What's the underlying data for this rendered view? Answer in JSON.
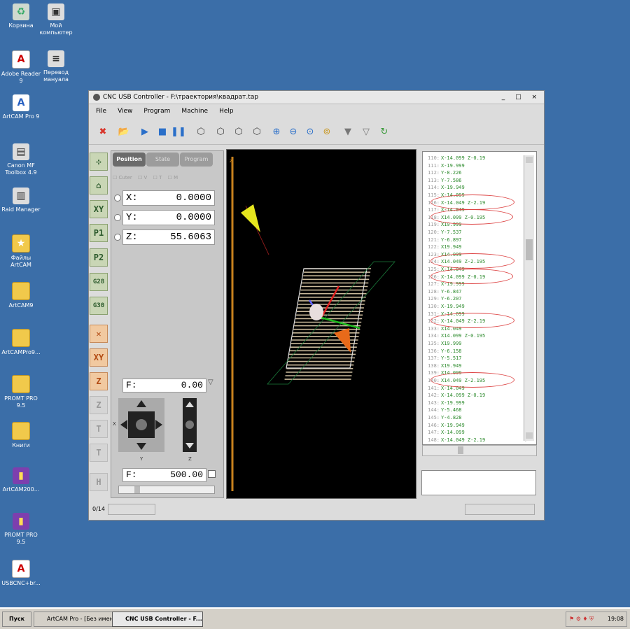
{
  "desktop": {
    "icons": [
      {
        "label": "Корзина",
        "glyph": "♻",
        "kind": "bin"
      },
      {
        "label": "Мой компьютер",
        "glyph": "▣",
        "kind": "app"
      },
      {
        "label": "Adobe Reader 9",
        "glyph": "A",
        "kind": "pdf"
      },
      {
        "label": "Перевод мануала",
        "glyph": "≡",
        "kind": "app"
      },
      {
        "label": "ArtCAM Pro 9",
        "glyph": "A",
        "kind": "art"
      },
      {
        "label": "Canon MF Toolbox 4.9",
        "glyph": "▤",
        "kind": "app"
      },
      {
        "label": "Raid Manager",
        "glyph": "▥",
        "kind": "app"
      },
      {
        "label": "Файлы ArtCAM",
        "glyph": "★",
        "kind": "folder"
      },
      {
        "label": "ArtCAM9",
        "glyph": "",
        "kind": "folder"
      },
      {
        "label": "ArtCAMPro9...",
        "glyph": "",
        "kind": "folder"
      },
      {
        "label": "PROMT PRO 9.5",
        "glyph": "",
        "kind": "folder"
      },
      {
        "label": "Книги",
        "glyph": "",
        "kind": "folder"
      },
      {
        "label": "ArtCAM200...",
        "glyph": "▮",
        "kind": "rar"
      },
      {
        "label": "PROMT PRO 9.5",
        "glyph": "▮",
        "kind": "rar"
      },
      {
        "label": "USBCNC+br...",
        "glyph": "A",
        "kind": "pdf"
      }
    ]
  },
  "window": {
    "title": "CNC USB Controller - F:\\траектория\\квадрат.tap",
    "controls": "_ □ ×",
    "menu": [
      "File",
      "View",
      "Program",
      "Machine",
      "Help"
    ]
  },
  "toolbar_icons": [
    {
      "name": "stop-icon",
      "glyph": "✖",
      "color": "#d8342a"
    },
    {
      "name": "open-folder-icon",
      "glyph": "📂",
      "color": "#e2a628"
    },
    {
      "name": "play-icon",
      "glyph": "▶",
      "color": "#2a6fc9"
    },
    {
      "name": "stop-square-icon",
      "glyph": "■",
      "color": "#2a6fc9"
    },
    {
      "name": "pause-icon",
      "glyph": "❚❚",
      "color": "#2a6fc9"
    },
    {
      "name": "view-iso-icon",
      "glyph": "⬡",
      "color": "#444"
    },
    {
      "name": "view-front-icon",
      "glyph": "⬡",
      "color": "#444"
    },
    {
      "name": "view-side-icon",
      "glyph": "⬡",
      "color": "#444"
    },
    {
      "name": "view-top-icon",
      "glyph": "⬡",
      "color": "#444"
    },
    {
      "name": "zoom-in-icon",
      "glyph": "⊕",
      "color": "#2a6fc9"
    },
    {
      "name": "zoom-out-icon",
      "glyph": "⊖",
      "color": "#2a6fc9"
    },
    {
      "name": "zoom-fit-icon",
      "glyph": "⊙",
      "color": "#2a6fc9"
    },
    {
      "name": "zoom-window-icon",
      "glyph": "⊚",
      "color": "#c99a28"
    },
    {
      "name": "filter-icon",
      "glyph": "▼",
      "color": "#777"
    },
    {
      "name": "filter-settings-icon",
      "glyph": "▽",
      "color": "#777"
    },
    {
      "name": "refresh-icon",
      "glyph": "↻",
      "color": "#3a9a3a"
    }
  ],
  "left_buttons": [
    {
      "name": "jog-all-button",
      "glyph": "✣",
      "style": "green"
    },
    {
      "name": "home-button",
      "glyph": "⌂",
      "style": "green"
    },
    {
      "name": "xy-zero-button",
      "glyph": "XY",
      "style": "green"
    },
    {
      "name": "p1-button",
      "glyph": "P1",
      "style": "green"
    },
    {
      "name": "p2-button",
      "glyph": "P2",
      "style": "green"
    },
    {
      "name": "g28-button",
      "glyph": "G28",
      "style": "green"
    },
    {
      "name": "g30-button",
      "glyph": "G30",
      "style": "green"
    },
    {
      "name": "zero-all-button",
      "glyph": "✕",
      "style": "orange"
    },
    {
      "name": "zero-xy-button",
      "glyph": "XY",
      "style": "orange"
    },
    {
      "name": "zero-z-button",
      "glyph": "Z",
      "style": "orange"
    },
    {
      "name": "probe-z-button",
      "glyph": "Z",
      "style": "grey"
    },
    {
      "name": "tool-button",
      "glyph": "T",
      "style": "grey"
    },
    {
      "name": "tool-change-button",
      "glyph": "T",
      "style": "grey"
    },
    {
      "name": "home-machine-button",
      "glyph": "H",
      "style": "grey"
    }
  ],
  "panel": {
    "tabs": [
      "Position",
      "State",
      "Program"
    ],
    "checks": [
      "Cuter",
      "V",
      "T",
      "M"
    ],
    "x_label": "X:",
    "x_value": "0.0000",
    "y_label": "Y:",
    "y_value": "0.0000",
    "z_label": "Z:",
    "z_value": "55.6063",
    "feed_label": "F:",
    "feed_value": "0.00",
    "jog_feed_label": "F:",
    "jog_feed_value": "500.00",
    "axis_x": "X",
    "axis_y": "Y",
    "axis_z": "Z"
  },
  "gcode": [
    {
      "n": "110:",
      "t": "X-14.099 Z-0.19"
    },
    {
      "n": "111:",
      "t": "X-19.999"
    },
    {
      "n": "112:",
      "t": "Y-8.226"
    },
    {
      "n": "113:",
      "t": "Y-7.586"
    },
    {
      "n": "114:",
      "t": "X-19.949"
    },
    {
      "n": "115:",
      "t": "X-14.099"
    },
    {
      "n": "116:",
      "t": "X-14.049 Z-2.19"
    },
    {
      "n": "117:",
      "t": "X-14.049"
    },
    {
      "n": "118:",
      "t": "X14.099 Z-0.195"
    },
    {
      "n": "119:",
      "t": "X19.999"
    },
    {
      "n": "120:",
      "t": "Y-7.537"
    },
    {
      "n": "121:",
      "t": "Y-6.897"
    },
    {
      "n": "122:",
      "t": "X19.949"
    },
    {
      "n": "123:",
      "t": "X14.099"
    },
    {
      "n": "124:",
      "t": "X14.049 Z-2.195"
    },
    {
      "n": "125:",
      "t": "X-14.049"
    },
    {
      "n": "126:",
      "t": "X-14.099 Z-0.19"
    },
    {
      "n": "127:",
      "t": "X-19.999"
    },
    {
      "n": "128:",
      "t": "Y-6.847"
    },
    {
      "n": "129:",
      "t": "Y-6.207"
    },
    {
      "n": "130:",
      "t": "X-19.949"
    },
    {
      "n": "131:",
      "t": "X-14.099"
    },
    {
      "n": "132:",
      "t": "X-14.049 Z-2.19"
    },
    {
      "n": "133:",
      "t": "X14.049"
    },
    {
      "n": "134:",
      "t": "X14.099 Z-0.195"
    },
    {
      "n": "135:",
      "t": "X19.999"
    },
    {
      "n": "136:",
      "t": "Y-6.158"
    },
    {
      "n": "137:",
      "t": "Y-5.517"
    },
    {
      "n": "138:",
      "t": "X19.949"
    },
    {
      "n": "139:",
      "t": "X14.099"
    },
    {
      "n": "140:",
      "t": "X14.049 Z-2.195"
    },
    {
      "n": "141:",
      "t": "X-14.049"
    },
    {
      "n": "142:",
      "t": "X-14.099 Z-0.19"
    },
    {
      "n": "143:",
      "t": "X-19.999"
    },
    {
      "n": "144:",
      "t": "Y-5.468"
    },
    {
      "n": "145:",
      "t": "Y-4.828"
    },
    {
      "n": "146:",
      "t": "X-19.949"
    },
    {
      "n": "147:",
      "t": "X-14.099"
    },
    {
      "n": "148:",
      "t": "X-14.049 Z-2.19"
    }
  ],
  "status": {
    "progress": "0/14"
  },
  "taskbar": {
    "start": "Пуск",
    "tasks": [
      "ArtCAM Pro - [Без имени...",
      "CNC USB Controller - F..."
    ],
    "clock": "19:08"
  }
}
